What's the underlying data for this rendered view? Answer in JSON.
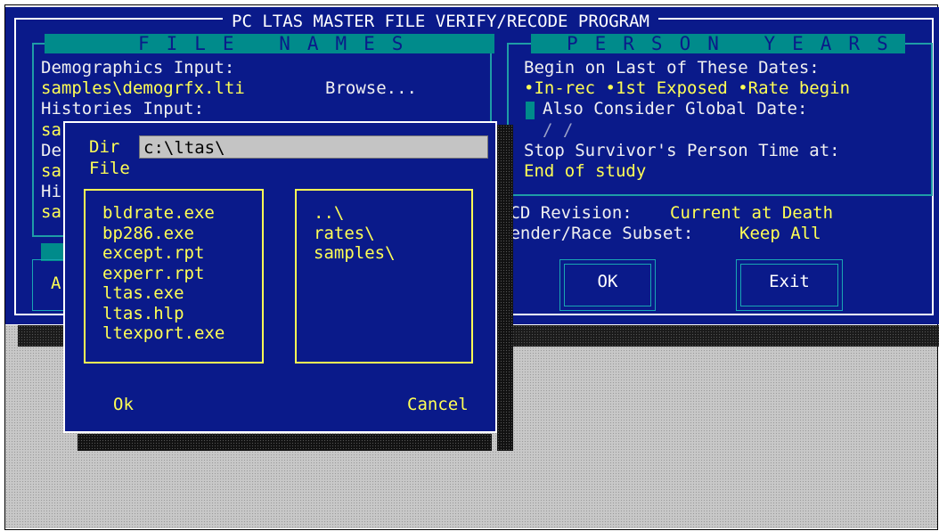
{
  "main_window": {
    "title": "PC LTAS MASTER FILE VERIFY/RECODE PROGRAM"
  },
  "file_names": {
    "heading": "FILE NAMES",
    "demographics_label": "Demographics Input:",
    "demographics_value": "samples\\demogrfx.lti",
    "browse_label": "Browse...",
    "histories_label": "Histories Input:",
    "obscured_fragments": [
      "sa",
      "De",
      "sa",
      "Hi",
      "sa"
    ],
    "partial_button_label": "A"
  },
  "person_years": {
    "heading": "PERSON YEARS",
    "begin_label": "Begin on Last of These Dates:",
    "begin_options": "•In-rec •1st Exposed •Rate begin",
    "also_consider": "Also Consider Global Date:",
    "date_placeholder": " /  /",
    "stop_label": "Stop Survivor's Person Time at:",
    "stop_value": "End of study"
  },
  "icd_revision": {
    "label": "ICD Revision:",
    "value": "Current at Death"
  },
  "gender_race": {
    "label": "Gender/Race Subset:",
    "value": "Keep All"
  },
  "buttons": {
    "ok": "OK",
    "exit": "Exit"
  },
  "browse_dialog": {
    "dir_label": "Dir",
    "dir_value": "c:\\ltas\\",
    "file_label": "File",
    "files": [
      "bldrate.exe",
      "bp286.exe",
      "except.rpt",
      "experr.rpt",
      "ltas.exe",
      "ltas.hlp",
      "ltexport.exe"
    ],
    "directories": [
      "..\\",
      "rates\\",
      "samples\\"
    ],
    "ok_label": "Ok",
    "cancel_label": "Cancel"
  },
  "colors": {
    "window_bg": "#0a1a8a",
    "highlight_text": "#ffff55",
    "normal_text": "#f0f0f0",
    "heading_bar": "#008b8b",
    "input_bg": "#c4c4c4",
    "desktop": "#c8c8c8"
  }
}
